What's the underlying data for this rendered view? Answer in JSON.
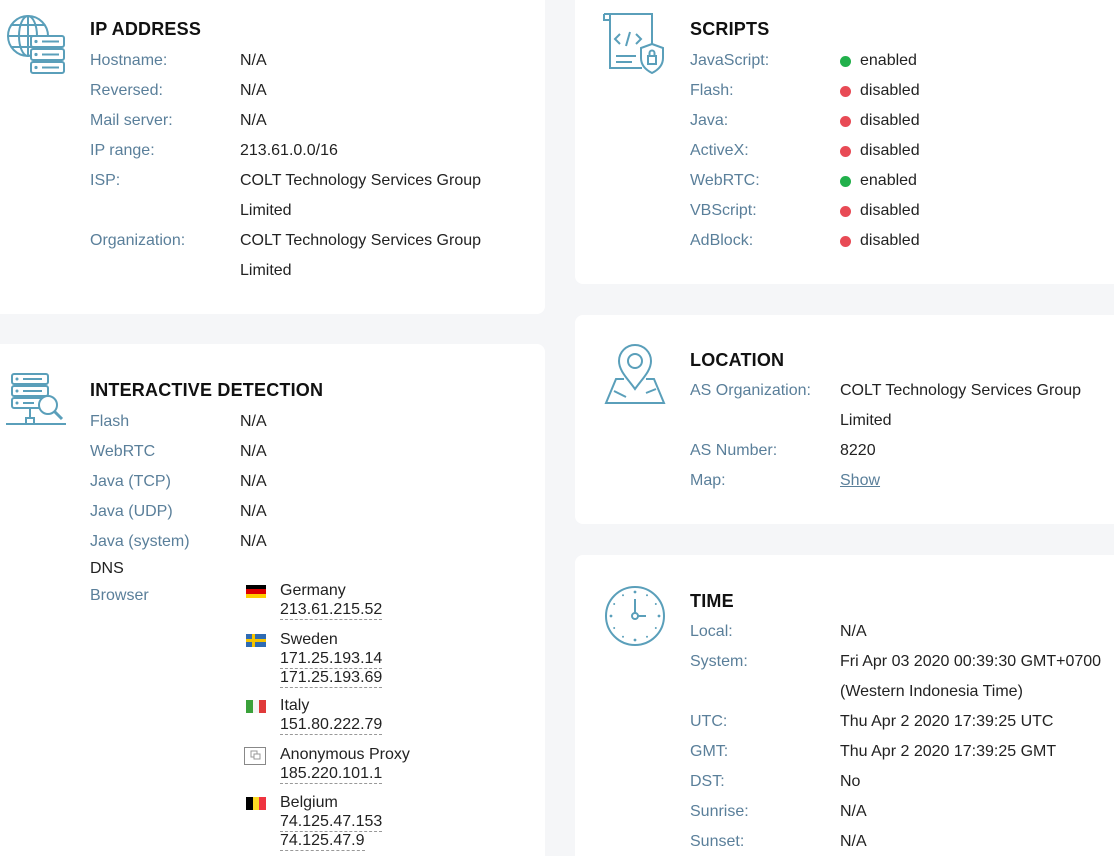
{
  "ip_address": {
    "title": "IP ADDRESS",
    "rows": [
      {
        "label": "Hostname:",
        "value": "N/A"
      },
      {
        "label": "Reversed:",
        "value": "N/A"
      },
      {
        "label": "Mail server:",
        "value": "N/A"
      },
      {
        "label": "IP range:",
        "value": "213.61.0.0/16"
      },
      {
        "label": "ISP:",
        "value_line1": "COLT Technology Services Group",
        "value_line2": "Limited"
      },
      {
        "label": "Organization:",
        "value_line1": "COLT Technology Services Group",
        "value_line2": "Limited"
      }
    ]
  },
  "scripts": {
    "title": "SCRIPTS",
    "rows": [
      {
        "label": "JavaScript:",
        "value": "enabled",
        "status": "green"
      },
      {
        "label": "Flash:",
        "value": "disabled",
        "status": "red"
      },
      {
        "label": "Java:",
        "value": "disabled",
        "status": "red"
      },
      {
        "label": "ActiveX:",
        "value": "disabled",
        "status": "red"
      },
      {
        "label": "WebRTC:",
        "value": "enabled",
        "status": "green"
      },
      {
        "label": "VBScript:",
        "value": "disabled",
        "status": "red"
      },
      {
        "label": "AdBlock:",
        "value": "disabled",
        "status": "red"
      }
    ],
    "colors": {
      "green": "#21b04b",
      "red": "#e84a55"
    }
  },
  "location": {
    "title": "LOCATION",
    "rows": [
      {
        "label": "AS Organization:",
        "value_line1": "COLT Technology Services Group",
        "value_line2": "Limited"
      },
      {
        "label": "AS Number:",
        "value": "8220"
      },
      {
        "label": "Map:",
        "value": "Show"
      }
    ]
  },
  "interactive": {
    "title": "INTERACTIVE DETECTION",
    "rows": [
      {
        "label": "Flash",
        "value": "N/A"
      },
      {
        "label": "WebRTC",
        "value": "N/A"
      },
      {
        "label": "Java (TCP)",
        "value": "N/A"
      },
      {
        "label": "Java (UDP)",
        "value": "N/A"
      },
      {
        "label": "Java (system)",
        "value": "N/A"
      }
    ],
    "dns_label": "DNS",
    "browser_label": "Browser",
    "dns_entries": [
      {
        "country": "Germany",
        "flag": "de",
        "ips": [
          "213.61.215.52"
        ]
      },
      {
        "country": "Sweden",
        "flag": "se",
        "ips": [
          "171.25.193.14",
          "171.25.193.69"
        ]
      },
      {
        "country": "Italy",
        "flag": "it",
        "ips": [
          "151.80.222.79"
        ]
      },
      {
        "country": "Anonymous Proxy",
        "flag": "proxy",
        "ips": [
          "185.220.101.1"
        ]
      },
      {
        "country": "Belgium",
        "flag": "be",
        "ips": [
          "74.125.47.153",
          "74.125.47.9"
        ]
      }
    ]
  },
  "time": {
    "title": "TIME",
    "rows": [
      {
        "label": "Local:",
        "value": "N/A"
      },
      {
        "label": "System:",
        "value_line1": "Fri Apr 03 2020 00:39:30 GMT+0700",
        "value_line2": "(Western Indonesia Time)"
      },
      {
        "label": "UTC:",
        "value": "Thu Apr 2 2020 17:39:25 UTC"
      },
      {
        "label": "GMT:",
        "value": "Thu Apr 2 2020 17:39:25 GMT"
      },
      {
        "label": "DST:",
        "value": "No"
      },
      {
        "label": "Sunrise:",
        "value": "N/A"
      },
      {
        "label": "Sunset:",
        "value": "N/A"
      }
    ]
  },
  "icons": {
    "ip": "globe-server-icon",
    "scripts": "code-shield-icon",
    "location": "map-pin-icon",
    "interactive": "server-search-icon",
    "time": "clock-icon"
  },
  "accent_color": "#5a9fba",
  "label_color": "#5a7f9a"
}
